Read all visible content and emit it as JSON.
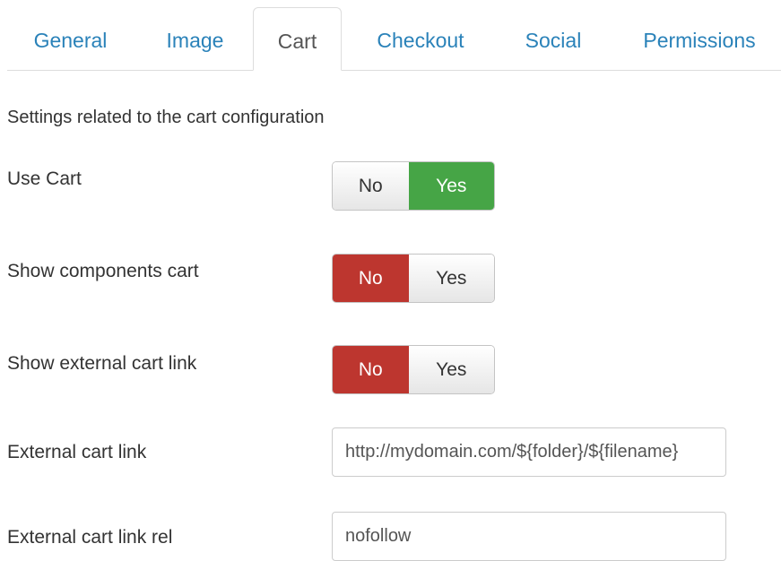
{
  "tabs": [
    {
      "label": "General",
      "active": false
    },
    {
      "label": "Image",
      "active": false
    },
    {
      "label": "Cart",
      "active": true
    },
    {
      "label": "Checkout",
      "active": false
    },
    {
      "label": "Social",
      "active": false
    },
    {
      "label": "Permissions",
      "active": false
    }
  ],
  "description": "Settings related to the cart configuration",
  "fields": {
    "use_cart": {
      "label": "Use Cart",
      "no": "No",
      "yes": "Yes",
      "value": "Yes"
    },
    "show_components_cart": {
      "label": "Show components cart",
      "no": "No",
      "yes": "Yes",
      "value": "No"
    },
    "show_external_cart_link": {
      "label": "Show external cart link",
      "no": "No",
      "yes": "Yes",
      "value": "No"
    },
    "external_cart_link": {
      "label": "External cart link",
      "value": "http://mydomain.com/${folder}/${filename}"
    },
    "external_cart_link_rel": {
      "label": "External cart link rel",
      "value": "nofollow"
    }
  },
  "colors": {
    "link": "#2a82b9",
    "yes_active": "#46a546",
    "no_active": "#bd362f"
  }
}
